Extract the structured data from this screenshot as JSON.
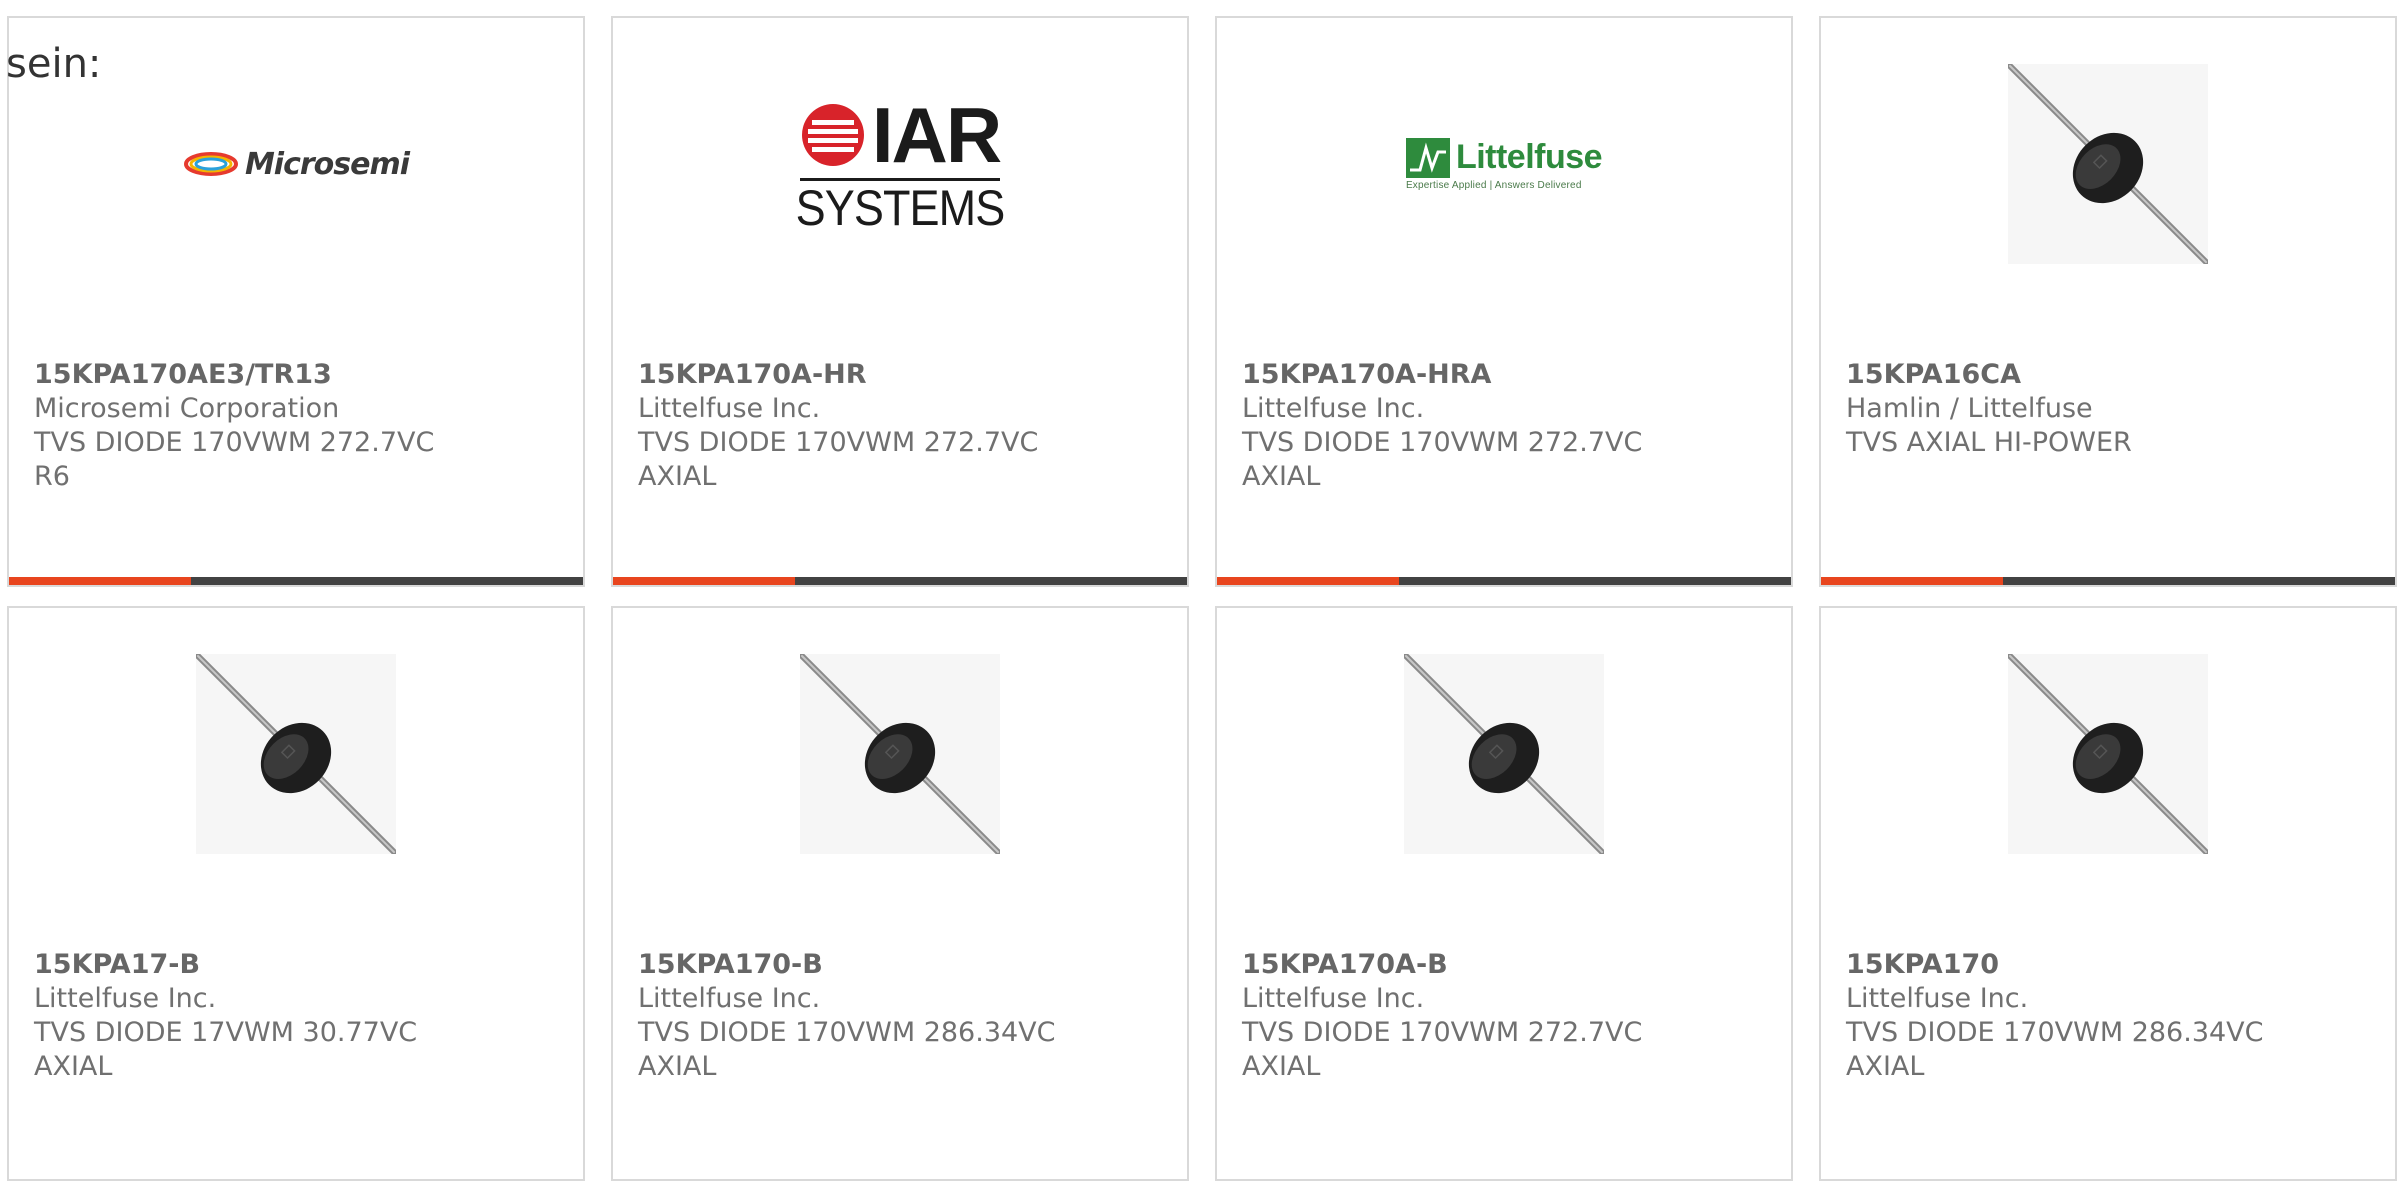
{
  "intro_text": "sein:",
  "products": [
    {
      "part_number": "15KPA170AE3/TR13",
      "manufacturer": "Microsemi Corporation",
      "description": "TVS DIODE 170VWM 272.7VC R6",
      "image": "microsemi-logo"
    },
    {
      "part_number": "15KPA170A-HR",
      "manufacturer": "Littelfuse Inc.",
      "description": "TVS DIODE 170VWM 272.7VC AXIAL",
      "image": "iar-systems-logo"
    },
    {
      "part_number": "15KPA170A-HRA",
      "manufacturer": "Littelfuse Inc.",
      "description": "TVS DIODE 170VWM 272.7VC AXIAL",
      "image": "littelfuse-logo"
    },
    {
      "part_number": "15KPA16CA",
      "manufacturer": "Hamlin / Littelfuse",
      "description": "TVS AXIAL HI-POWER",
      "image": "axial-diode-photo"
    },
    {
      "part_number": "15KPA17-B",
      "manufacturer": "Littelfuse Inc.",
      "description": "TVS DIODE 17VWM 30.77VC AXIAL",
      "image": "axial-diode-photo"
    },
    {
      "part_number": "15KPA170-B",
      "manufacturer": "Littelfuse Inc.",
      "description": "TVS DIODE 170VWM 286.34VC AXIAL",
      "image": "axial-diode-photo"
    },
    {
      "part_number": "15KPA170A-B",
      "manufacturer": "Littelfuse Inc.",
      "description": "TVS DIODE 170VWM 272.7VC AXIAL",
      "image": "axial-diode-photo"
    },
    {
      "part_number": "15KPA170",
      "manufacturer": "Littelfuse Inc.",
      "description": "TVS DIODE 170VWM 286.34VC AXIAL",
      "image": "axial-diode-photo"
    }
  ],
  "logos": {
    "microsemi": "Microsemi",
    "iar_top": "IAR",
    "iar_bottom": "SYSTEMS",
    "littelfuse_word": "Littelfuse",
    "littelfuse_tag": "Expertise Applied | Answers Delivered"
  },
  "colors": {
    "accent": "#e8451e",
    "bar_dark": "#424242",
    "card_border": "#d9d9d9",
    "text_gray": "#707070"
  }
}
